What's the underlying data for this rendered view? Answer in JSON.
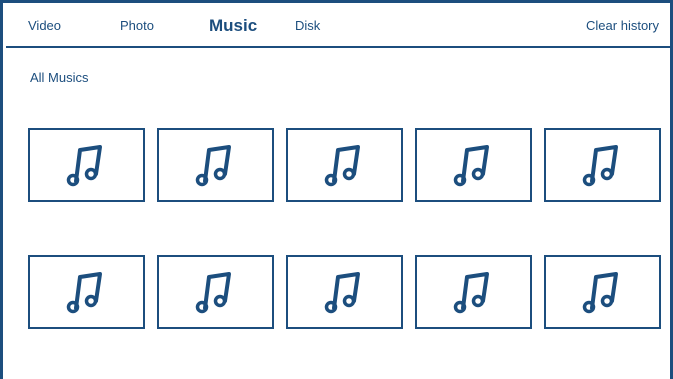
{
  "nav": {
    "tabs": [
      {
        "label": "Video",
        "active": false
      },
      {
        "label": "Photo",
        "active": false
      },
      {
        "label": "Music",
        "active": true
      },
      {
        "label": "Disk",
        "active": false
      }
    ],
    "clear_history_label": "Clear history"
  },
  "section": {
    "title": "All Musics"
  },
  "grid": {
    "item_icon": "music-note-icon",
    "items": [
      {
        "icon": "music-note-icon"
      },
      {
        "icon": "music-note-icon"
      },
      {
        "icon": "music-note-icon"
      },
      {
        "icon": "music-note-icon"
      },
      {
        "icon": "music-note-icon"
      },
      {
        "icon": "music-note-icon"
      },
      {
        "icon": "music-note-icon"
      },
      {
        "icon": "music-note-icon"
      },
      {
        "icon": "music-note-icon"
      },
      {
        "icon": "music-note-icon"
      }
    ]
  },
  "colors": {
    "accent": "#1c4e7e",
    "background": "#ffffff"
  }
}
